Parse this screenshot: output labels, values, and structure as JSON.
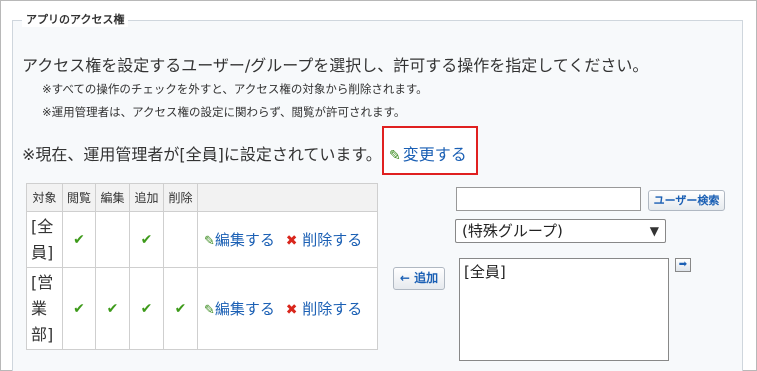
{
  "section": {
    "legend": "アプリのアクセス権"
  },
  "description": {
    "main": "アクセス権を設定するユーザー/グループを選択し、許可する操作を指定してください。",
    "note1": "※すべての操作のチェックを外すと、アクセス権の対象から削除されます。",
    "note2": "※運用管理者は、アクセス権の設定に関わらず、閲覧が許可されます。"
  },
  "admin": {
    "status": "※現在、運用管理者が[全員]に設定されています。",
    "change_label": "変更する"
  },
  "table": {
    "headers": [
      "対象",
      "閲覧",
      "編集",
      "追加",
      "削除"
    ],
    "rows": [
      {
        "target": "[全員]",
        "view": true,
        "edit": false,
        "add": true,
        "delete": false,
        "edit_label": "編集する",
        "delete_label": "削除する"
      },
      {
        "target": "[営業部]",
        "view": true,
        "edit": true,
        "add": true,
        "delete": true,
        "edit_label": "編集する",
        "delete_label": "削除する"
      }
    ]
  },
  "add_button": "← 追加",
  "search": {
    "value": "",
    "button_label": "ユーザー検索"
  },
  "group_select": {
    "selected": "(特殊グループ)"
  },
  "listbox": {
    "items": [
      "[全員]"
    ]
  },
  "icons": {
    "pencil": "pencil-icon",
    "check": "check-icon",
    "delete": "x-icon",
    "move": "arrow-right-icon"
  },
  "colors": {
    "link": "#1a5fb4",
    "check": "#3d9a1a",
    "delete_x": "#d9261c",
    "highlight": "#e02020"
  }
}
